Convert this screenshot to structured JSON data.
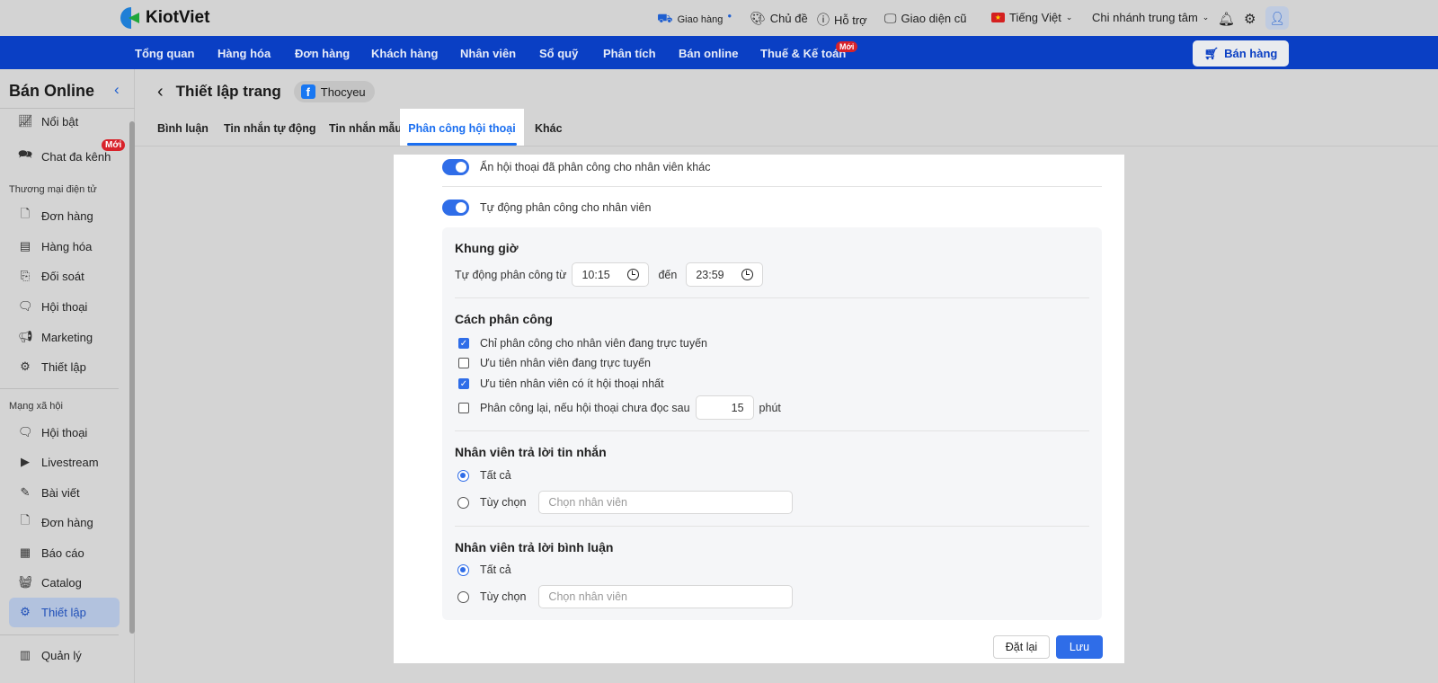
{
  "topbar": {
    "brand": "KiotViet",
    "shipping": "Giao hàng",
    "theme": "Chủ đề",
    "support": "Hỗ trợ",
    "old_ui": "Giao diện cũ",
    "language": "Tiếng Việt",
    "branch": "Chi nhánh trung tâm"
  },
  "nav": {
    "items": [
      "Tổng quan",
      "Hàng hóa",
      "Đơn hàng",
      "Khách hàng",
      "Nhân viên",
      "Sổ quỹ",
      "Phân tích",
      "Bán online",
      "Thuế & Kế toán"
    ],
    "new_badge": "Mới",
    "sell_button": "Bán hàng"
  },
  "sidebar": {
    "title": "Bán Online",
    "new_badge": "Mới",
    "top_items": [
      "Nổi bật",
      "Chat đa kênh"
    ],
    "section1": "Thương mại điện tử",
    "section1_items": [
      "Đơn hàng",
      "Hàng hóa",
      "Đối soát",
      "Hội thoại",
      "Marketing",
      "Thiết lập"
    ],
    "section2": "Mạng xã hội",
    "section2_items": [
      "Hội thoại",
      "Livestream",
      "Bài viết",
      "Đơn hàng",
      "Báo cáo",
      "Catalog",
      "Thiết lập"
    ],
    "bottom_item": "Quản lý"
  },
  "header": {
    "title": "Thiết lập trang",
    "page_name": "Thocyeu"
  },
  "tabs": [
    "Bình luận",
    "Tin nhắn tự động",
    "Tin nhắn mẫu",
    "Phân công hội thoại",
    "Khác"
  ],
  "settings": {
    "hide_assigned": {
      "label": "Ẩn hội thoại đã phân công cho nhân viên khác",
      "on": true
    },
    "auto_assign": {
      "label": "Tự động phân công cho nhân viên",
      "on": true
    },
    "time_frame": {
      "title": "Khung giờ",
      "from_label": "Tự động phân công từ",
      "from": "10:15",
      "to_label": "đến",
      "to": "23:59"
    },
    "method": {
      "title": "Cách phân công",
      "options": [
        {
          "label": "Chỉ phân công cho nhân viên đang trực tuyến",
          "checked": true
        },
        {
          "label": "Ưu tiên nhân viên đang trực tuyến",
          "checked": false
        },
        {
          "label": "Ưu tiên nhân viên có ít hội thoại nhất",
          "checked": true
        },
        {
          "label": "Phân công lại, nếu hội thoại chưa đọc sau",
          "checked": false
        }
      ],
      "minutes": "15",
      "minutes_unit": "phút"
    },
    "reply_messages": {
      "title": "Nhân viên trả lời tin nhắn",
      "all": "Tất cả",
      "custom": "Tùy chọn",
      "placeholder": "Chọn nhân viên",
      "selected": "all"
    },
    "reply_comments": {
      "title": "Nhân viên trả lời bình luận",
      "all": "Tất cả",
      "custom": "Tùy chọn",
      "placeholder": "Chọn nhân viên",
      "selected": "all"
    }
  },
  "actions": {
    "reset": "Đặt lại",
    "save": "Lưu"
  },
  "colors": {
    "nav": "#0a3fc4",
    "accent": "#2f6de8"
  }
}
